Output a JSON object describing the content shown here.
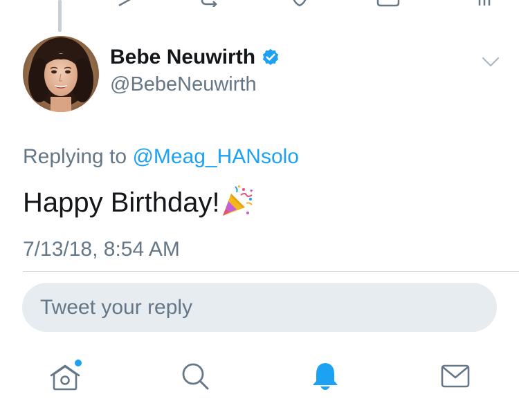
{
  "tweet": {
    "author_name": "Bebe Neuwirth",
    "author_handle": "@BebeNeuwirth",
    "replying_prefix": "Replying to ",
    "replying_to": "@Meag_HANsolo",
    "text": "Happy Birthday!",
    "timestamp": "7/13/18, 8:54 AM"
  },
  "reply": {
    "placeholder": "Tweet your reply"
  },
  "icons": {
    "verified": "verified-badge-icon",
    "more": "chevron-down-icon",
    "emoji": "party-popper-icon",
    "tabs": [
      "home-icon",
      "search-icon",
      "notifications-bell-icon",
      "messages-envelope-icon"
    ]
  },
  "colors": {
    "accent": "#1da1f2",
    "secondary_text": "#657786",
    "reply_box_bg": "#e6ecf0",
    "icon_gray": "#657786"
  },
  "tabbar": {
    "active_tab": "notifications",
    "home_has_new_indicator": true
  }
}
